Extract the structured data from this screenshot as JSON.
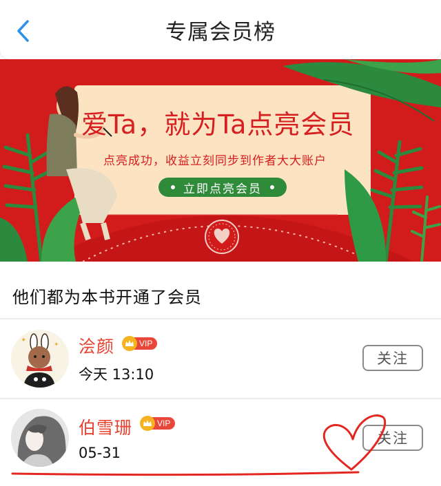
{
  "header": {
    "title": "专属会员榜",
    "back_icon": "chevron-left-icon"
  },
  "banner": {
    "headline": "爱Ta，就为Ta点亮会员",
    "subtitle": "点亮成功，收益立刻同步到作者大大账户",
    "button_label": "立即点亮会员"
  },
  "section": {
    "title": "他们都为本书开通了会员"
  },
  "members": [
    {
      "name": "浍颜",
      "vip_label": "VIP",
      "time": "今天 13:10",
      "follow_label": "关注"
    },
    {
      "name": "伯雪珊",
      "vip_label": "VIP",
      "time": "05-31",
      "follow_label": "关注"
    }
  ],
  "colors": {
    "accent_red": "#e8412f",
    "banner_red": "#d21b1b",
    "button_green": "#2f8a3a",
    "back_arrow_blue": "#2f8fe9"
  }
}
